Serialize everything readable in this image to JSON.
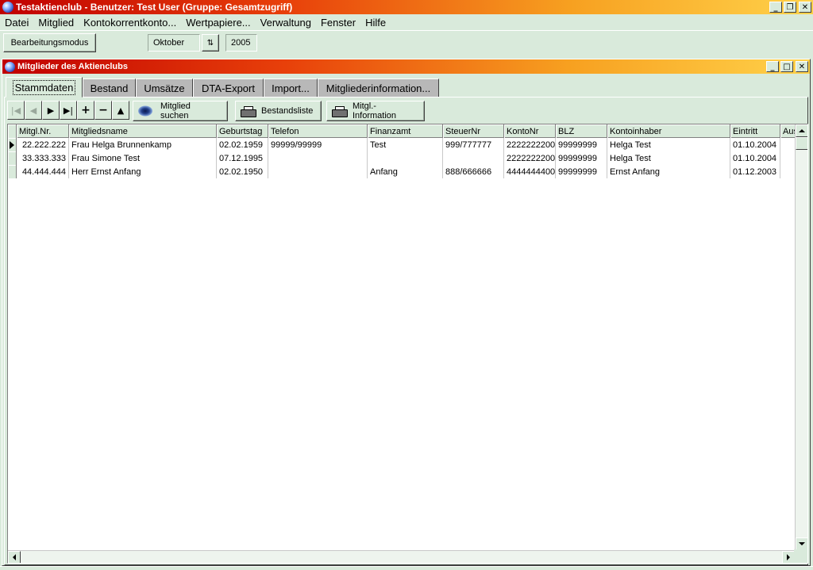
{
  "app": {
    "title": "Testaktienclub - Benutzer: Test User (Gruppe: Gesamtzugriff)"
  },
  "menu": [
    {
      "label": "Datei"
    },
    {
      "label": "Mitglied"
    },
    {
      "label": "Kontokorrentkonto..."
    },
    {
      "label": "Wertpapiere..."
    },
    {
      "label": "Verwaltung"
    },
    {
      "label": "Fenster"
    },
    {
      "label": "Hilfe"
    }
  ],
  "toolbar": {
    "mode_button": "Bearbeitungsmodus",
    "month": "Oktober",
    "year": "2005"
  },
  "child_window": {
    "title": "Mitglieder des Aktienclubs"
  },
  "tabs": [
    {
      "label": "Stammdaten",
      "active": true
    },
    {
      "label": "Bestand"
    },
    {
      "label": "Umsätze"
    },
    {
      "label": "DTA-Export"
    },
    {
      "label": "Import..."
    },
    {
      "label": "Mitgliederinformation..."
    }
  ],
  "actions": {
    "search_member": "Mitglied suchen",
    "holdings_list": "Bestandsliste",
    "member_info": "Mitgl.-Information"
  },
  "grid": {
    "columns": [
      "Mitgl.Nr.",
      "Mitgliedsname",
      "Geburtstag",
      "Telefon",
      "Finanzamt",
      "SteuerNr",
      "KontoNr",
      "BLZ",
      "Kontoinhaber",
      "Eintritt",
      "Aus"
    ],
    "rows": [
      [
        "22.222.222",
        "Frau Helga Brunnenkamp",
        "02.02.1959",
        "99999/99999",
        "Test",
        "999/777777",
        "2222222200",
        "99999999",
        "Helga Test",
        "01.10.2004",
        ""
      ],
      [
        "33.333.333",
        "Frau Simone Test",
        "07.12.1995",
        "",
        "",
        "",
        "2222222200",
        "99999999",
        "Helga Test",
        "01.10.2004",
        ""
      ],
      [
        "44.444.444",
        "Herr Ernst Anfang",
        "02.02.1950",
        "",
        "Anfang",
        "888/666666",
        "4444444400",
        "99999999",
        "Ernst Anfang",
        "01.12.2003",
        ""
      ]
    ]
  }
}
